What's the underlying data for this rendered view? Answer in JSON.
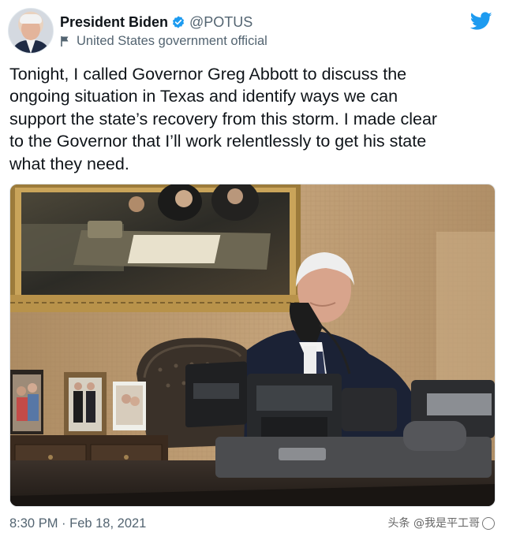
{
  "author": {
    "display_name": "President Biden",
    "handle": "@POTUS",
    "account_label": "United States government official",
    "verified_icon": "verified-badge-icon",
    "label_icon": "flag-icon"
  },
  "brand": {
    "icon": "twitter-bird-icon",
    "color": "#1d9bf0"
  },
  "tweet": {
    "text": "Tonight, I called Governor Greg Abbott to discuss the\nongoing situation in Texas and identify ways we can\nsupport the state’s recovery from this storm. I made clear\nto the Governor that I’ll work relentlessly to get his state\nwhat they need.",
    "timestamp": "8:30 PM · Feb 18, 2021"
  },
  "watermark": {
    "text": "头条 @我是平工哥"
  },
  "colors": {
    "primary_text": "#0f1419",
    "secondary_text": "#536471",
    "verified_blue": "#1d9bf0"
  }
}
